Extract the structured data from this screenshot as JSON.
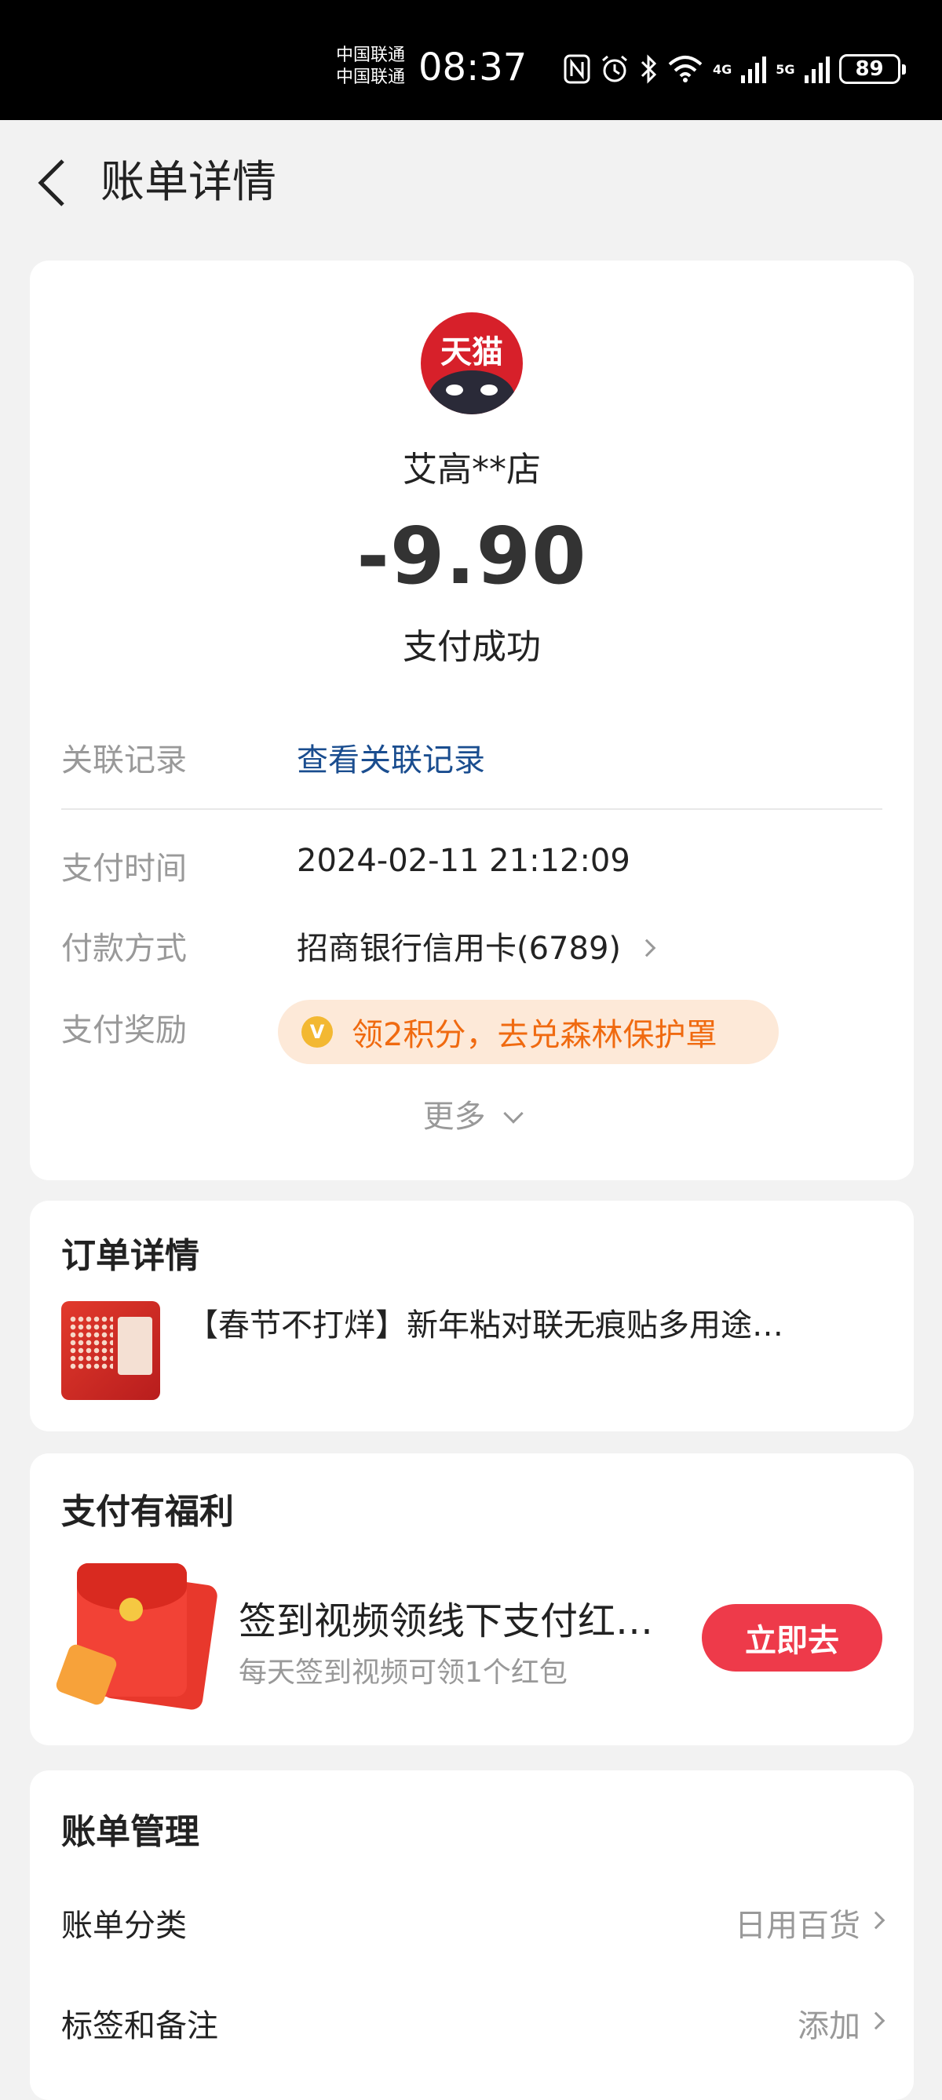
{
  "status_bar": {
    "carrier_1": "中国联通",
    "carrier_2": "中国联通",
    "time": "08:37",
    "net_4g": "4G",
    "net_5g": "5G",
    "battery": "89"
  },
  "nav": {
    "title": "账单详情"
  },
  "summary": {
    "logo_text": "天猫",
    "merchant": "艾高**店",
    "amount": "-9.90",
    "status": "支付成功"
  },
  "details": {
    "related_label": "关联记录",
    "related_link": "查看关联记录",
    "time_label": "支付时间",
    "time_value": "2024-02-11 21:12:09",
    "method_label": "付款方式",
    "method_value": "招商银行信用卡(6789)",
    "reward_label": "支付奖励",
    "reward_coin": "V",
    "reward_text": "领2积分，去兑森林保护罩",
    "more": "更多"
  },
  "order": {
    "title": "订单详情",
    "item_title": "【春节不打烊】新年粘对联无痕贴多用途…"
  },
  "benefit": {
    "title": "支付有福利",
    "headline": "签到视频领线下支付红…",
    "sub": "每天签到视频可领1个红包",
    "button": "立即去"
  },
  "manage": {
    "title": "账单管理",
    "rows": [
      {
        "label": "账单分类",
        "value": "日用百货"
      },
      {
        "label": "标签和备注",
        "value": "添加"
      }
    ]
  },
  "colors": {
    "accent_red": "#ee3a4a",
    "link_blue": "#1a4d8f",
    "reward_orange": "#f06a10"
  }
}
